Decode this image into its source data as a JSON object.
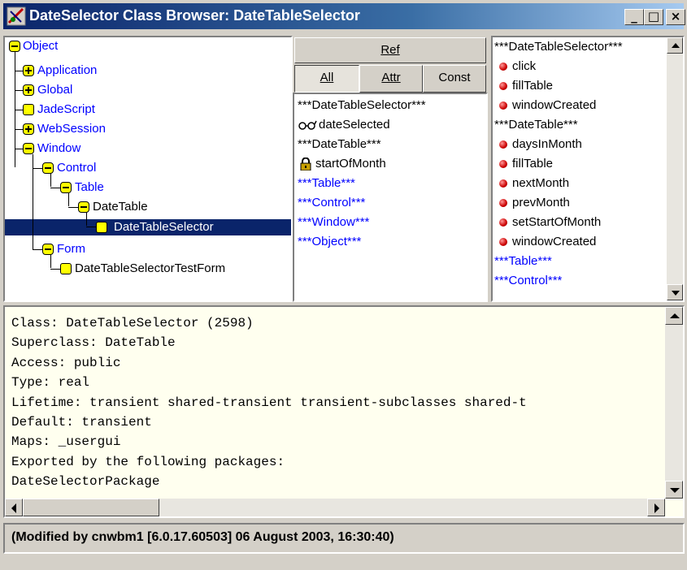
{
  "window": {
    "title": "DateSelector Class Browser: DateTableSelector",
    "minimize_label": "_",
    "maximize_label": "□",
    "close_label": "×"
  },
  "tree": {
    "items": [
      {
        "label": "Object",
        "color": "blue"
      },
      {
        "label": "Application",
        "color": "blue"
      },
      {
        "label": "Global",
        "color": "blue"
      },
      {
        "label": "JadeScript",
        "color": "blue"
      },
      {
        "label": "WebSession",
        "color": "blue"
      },
      {
        "label": "Window",
        "color": "blue"
      },
      {
        "label": "Control",
        "color": "blue"
      },
      {
        "label": "Table",
        "color": "blue"
      },
      {
        "label": "DateTable",
        "color": "black"
      },
      {
        "label": "DateTableSelector",
        "color": "white",
        "selected": true
      },
      {
        "label": "Form",
        "color": "blue"
      },
      {
        "label": "DateTableSelectorTestForm",
        "color": "black"
      }
    ]
  },
  "ref_tabs": {
    "ref": "Ref",
    "all": "All",
    "attr": "Attr",
    "const": "Const"
  },
  "references": [
    {
      "label": "***DateTableSelector***",
      "color": "black"
    },
    {
      "label": "dateSelected",
      "color": "black",
      "icon": "glasses-icon"
    },
    {
      "label": "***DateTable***",
      "color": "black"
    },
    {
      "label": "startOfMonth",
      "color": "black",
      "icon": "lock-icon"
    },
    {
      "label": "***Table***",
      "color": "blue"
    },
    {
      "label": "***Control***",
      "color": "blue"
    },
    {
      "label": "***Window***",
      "color": "blue"
    },
    {
      "label": "***Object***",
      "color": "blue"
    }
  ],
  "methods": [
    {
      "label": "***DateTableSelector***",
      "color": "black",
      "header": true
    },
    {
      "label": "click",
      "color": "black"
    },
    {
      "label": "fillTable",
      "color": "black"
    },
    {
      "label": "windowCreated",
      "color": "black"
    },
    {
      "label": "***DateTable***",
      "color": "black",
      "header": true
    },
    {
      "label": "daysInMonth",
      "color": "black"
    },
    {
      "label": "fillTable",
      "color": "black"
    },
    {
      "label": "nextMonth",
      "color": "black"
    },
    {
      "label": "prevMonth",
      "color": "black"
    },
    {
      "label": "setStartOfMonth",
      "color": "black"
    },
    {
      "label": "windowCreated",
      "color": "black"
    },
    {
      "label": "***Table***",
      "color": "blue",
      "header": true
    },
    {
      "label": "***Control***",
      "color": "blue",
      "header": true
    }
  ],
  "info_lines": [
    "Class: DateTableSelector (2598)",
    "Superclass: DateTable",
    "Access: public",
    "Type: real",
    "Lifetime: transient shared-transient transient-subclasses shared-t",
    "Default: transient",
    "Maps: _usergui",
    "Exported by the following packages:",
    "DateSelectorPackage"
  ],
  "status": "(Modified by cnwbm1 [6.0.17.60503] 06 August 2003, 16:30:40)",
  "colors": {
    "title_bar": "#0a246a",
    "tree_blue": "#0000ff",
    "selection": "#0a246a",
    "info_background": "#ffffef"
  }
}
